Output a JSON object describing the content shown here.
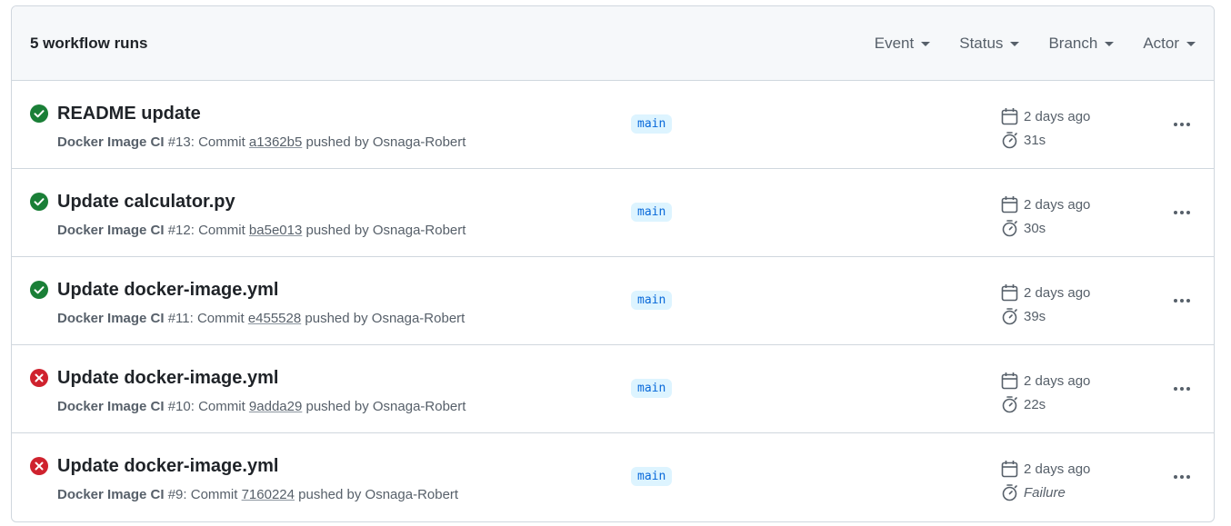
{
  "header": {
    "count_label": "5 workflow runs",
    "filters": [
      {
        "label": "Event"
      },
      {
        "label": "Status"
      },
      {
        "label": "Branch"
      },
      {
        "label": "Actor"
      }
    ]
  },
  "colors": {
    "success": "#1a7f37",
    "failure": "#cf222e",
    "branch_bg": "#ddf4ff",
    "branch_fg": "#0969da"
  },
  "runs": [
    {
      "status": "success",
      "title": "README update",
      "workflow": "Docker Image CI",
      "run_number": "#13",
      "commit_prefix": ": Commit ",
      "sha": "a1362b5",
      "pushed_by": " pushed by Osnaga-Robert",
      "branch": "main",
      "time_ago": "2 days ago",
      "duration": "31s"
    },
    {
      "status": "success",
      "title": "Update calculator.py",
      "workflow": "Docker Image CI",
      "run_number": "#12",
      "commit_prefix": ": Commit ",
      "sha": "ba5e013",
      "pushed_by": " pushed by Osnaga-Robert",
      "branch": "main",
      "time_ago": "2 days ago",
      "duration": "30s"
    },
    {
      "status": "success",
      "title": "Update docker-image.yml",
      "workflow": "Docker Image CI",
      "run_number": "#11",
      "commit_prefix": ": Commit ",
      "sha": "e455528",
      "pushed_by": " pushed by Osnaga-Robert",
      "branch": "main",
      "time_ago": "2 days ago",
      "duration": "39s"
    },
    {
      "status": "failure",
      "title": "Update docker-image.yml",
      "workflow": "Docker Image CI",
      "run_number": "#10",
      "commit_prefix": ": Commit ",
      "sha": "9adda29",
      "pushed_by": " pushed by Osnaga-Robert",
      "branch": "main",
      "time_ago": "2 days ago",
      "duration": "22s"
    },
    {
      "status": "failure",
      "title": "Update docker-image.yml",
      "workflow": "Docker Image CI",
      "run_number": "#9",
      "commit_prefix": ": Commit ",
      "sha": "7160224",
      "pushed_by": " pushed by Osnaga-Robert",
      "branch": "main",
      "time_ago": "2 days ago",
      "duration": "Failure"
    }
  ]
}
